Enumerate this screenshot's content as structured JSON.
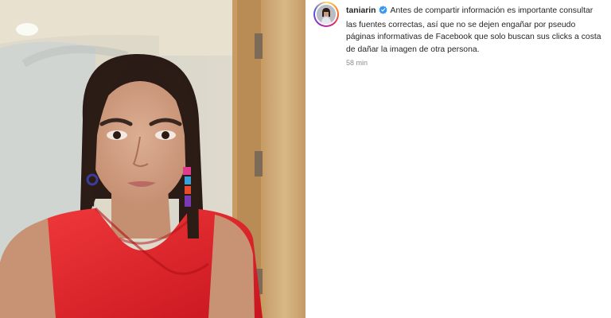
{
  "post": {
    "username": "taniarin",
    "caption": "Antes de compartir información es importante consultar las fuentes correctas, así que no se dejen engañar por pseudo páginas informativas de Facebook que solo buscan sus clicks a costa de dañar la imagen de otra persona.",
    "timestamp": "58 min",
    "verified": true
  },
  "colors": {
    "verified_badge": "#3897f0",
    "text": "#262626",
    "muted": "#8e8e8e",
    "dress": "#e8232b"
  },
  "icons": [
    "verified-badge-icon",
    "avatar"
  ]
}
